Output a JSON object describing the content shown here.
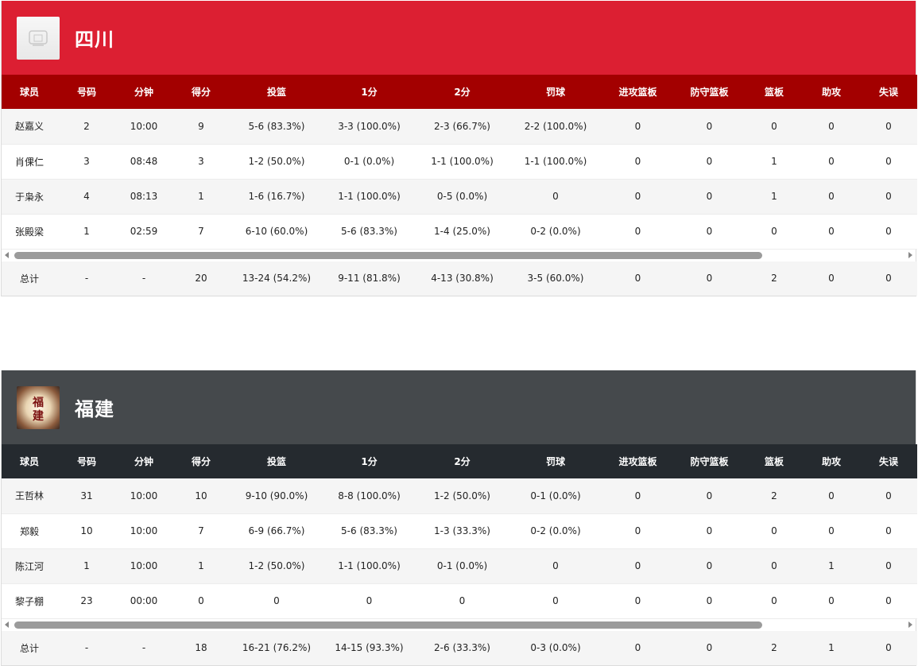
{
  "columns": [
    "球员",
    "号码",
    "分钟",
    "得分",
    "投篮",
    "1分",
    "2分",
    "罚球",
    "进攻篮板",
    "防守篮板",
    "篮板",
    "助攻",
    "失误"
  ],
  "teams": [
    {
      "name": "四川",
      "header_color": "#dc1f32",
      "thead_color": "#a30000",
      "logo_icon": "sichuan-team-logo",
      "players": [
        [
          "赵嘉义",
          "2",
          "10:00",
          "9",
          "5-6 (83.3%)",
          "3-3 (100.0%)",
          "2-3 (66.7%)",
          "2-2 (100.0%)",
          "0",
          "0",
          "0",
          "0",
          "0"
        ],
        [
          "肖倮仁",
          "3",
          "08:48",
          "3",
          "1-2 (50.0%)",
          "0-1 (0.0%)",
          "1-1 (100.0%)",
          "1-1 (100.0%)",
          "0",
          "0",
          "1",
          "0",
          "0"
        ],
        [
          "于枭永",
          "4",
          "08:13",
          "1",
          "1-6 (16.7%)",
          "1-1 (100.0%)",
          "0-5 (0.0%)",
          "0",
          "0",
          "0",
          "1",
          "0",
          "0"
        ],
        [
          "张殿梁",
          "1",
          "02:59",
          "7",
          "6-10 (60.0%)",
          "5-6 (83.3%)",
          "1-4 (25.0%)",
          "0-2 (0.0%)",
          "0",
          "0",
          "0",
          "0",
          "0"
        ]
      ],
      "total": [
        "总计",
        "-",
        "-",
        "20",
        "13-24 (54.2%)",
        "9-11 (81.8%)",
        "4-13 (30.8%)",
        "3-5 (60.0%)",
        "0",
        "0",
        "2",
        "0",
        "0"
      ]
    },
    {
      "name": "福建",
      "header_color": "#45494c",
      "thead_color": "#252a2f",
      "logo_icon": "fujian-team-logo",
      "logo_text": "福建",
      "players": [
        [
          "王哲林",
          "31",
          "10:00",
          "10",
          "9-10 (90.0%)",
          "8-8 (100.0%)",
          "1-2 (50.0%)",
          "0-1 (0.0%)",
          "0",
          "0",
          "2",
          "0",
          "0"
        ],
        [
          "郑毅",
          "10",
          "10:00",
          "7",
          "6-9 (66.7%)",
          "5-6 (83.3%)",
          "1-3 (33.3%)",
          "0-2 (0.0%)",
          "0",
          "0",
          "0",
          "0",
          "0"
        ],
        [
          "陈江河",
          "1",
          "10:00",
          "1",
          "1-2 (50.0%)",
          "1-1 (100.0%)",
          "0-1 (0.0%)",
          "0",
          "0",
          "0",
          "0",
          "1",
          "0"
        ],
        [
          "黎子棚",
          "23",
          "00:00",
          "0",
          "0",
          "0",
          "0",
          "0",
          "0",
          "0",
          "0",
          "0",
          "0"
        ]
      ],
      "total": [
        "总计",
        "-",
        "-",
        "18",
        "16-21 (76.2%)",
        "14-15 (93.3%)",
        "2-6 (33.3%)",
        "0-3 (0.0%)",
        "0",
        "0",
        "2",
        "1",
        "0"
      ]
    }
  ]
}
